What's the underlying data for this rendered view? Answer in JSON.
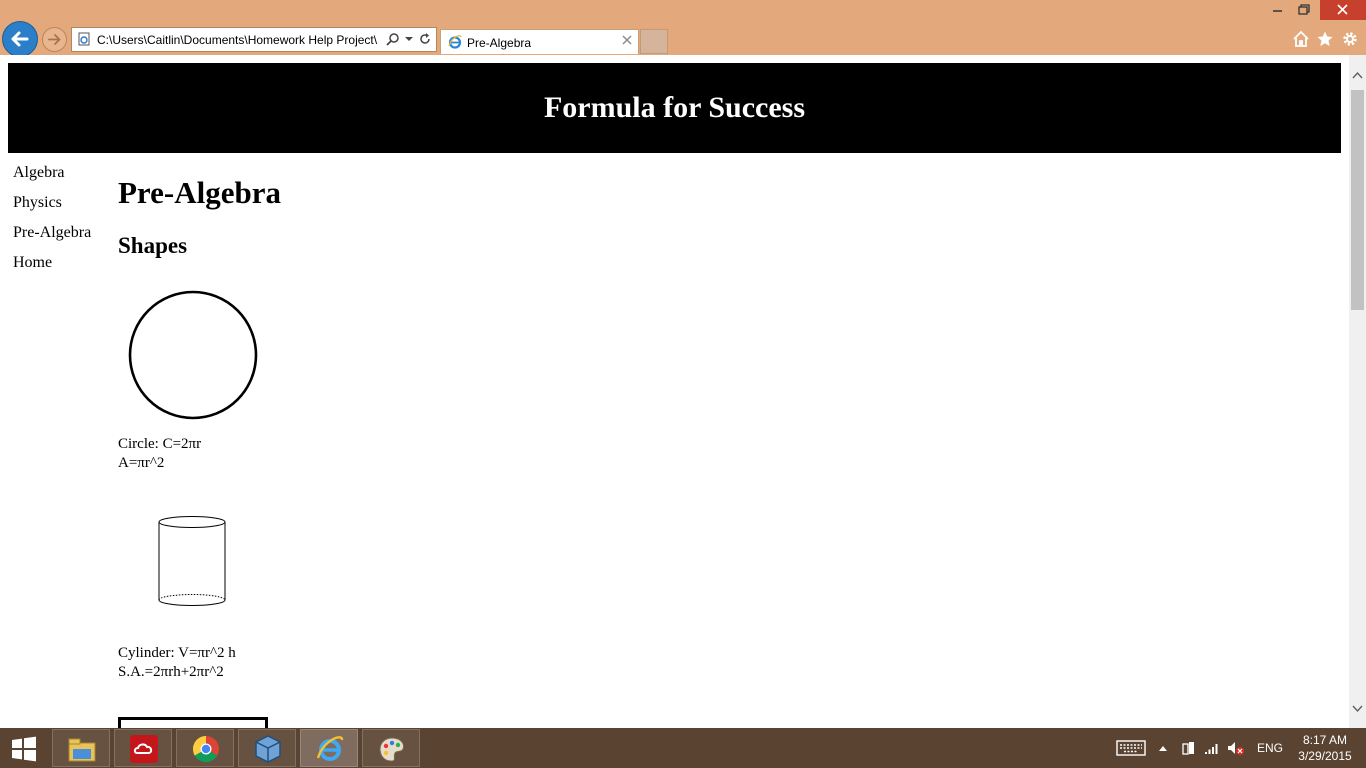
{
  "browser": {
    "address_url": "C:\\Users\\Caitlin\\Documents\\Homework Help Project\\",
    "tab_title": "Pre-Algebra"
  },
  "page": {
    "banner_title": "Formula for Success",
    "nav": [
      "Algebra",
      "Physics",
      "Pre-Algebra",
      "Home"
    ],
    "heading": "Pre-Algebra",
    "subheading": "Shapes",
    "circle_caption": [
      "Circle: C=2πr",
      "A=πr^2"
    ],
    "cylinder_caption": [
      "Cylinder: V=πr^2 h",
      "S.A.=2πrh+2πr^2"
    ]
  },
  "taskbar": {
    "apps": [
      "file-explorer",
      "adobe-creative-cloud",
      "chrome",
      "virtualbox",
      "internet-explorer",
      "paint"
    ],
    "language": "ENG",
    "time": "8:17 AM",
    "date": "3/29/2015"
  }
}
